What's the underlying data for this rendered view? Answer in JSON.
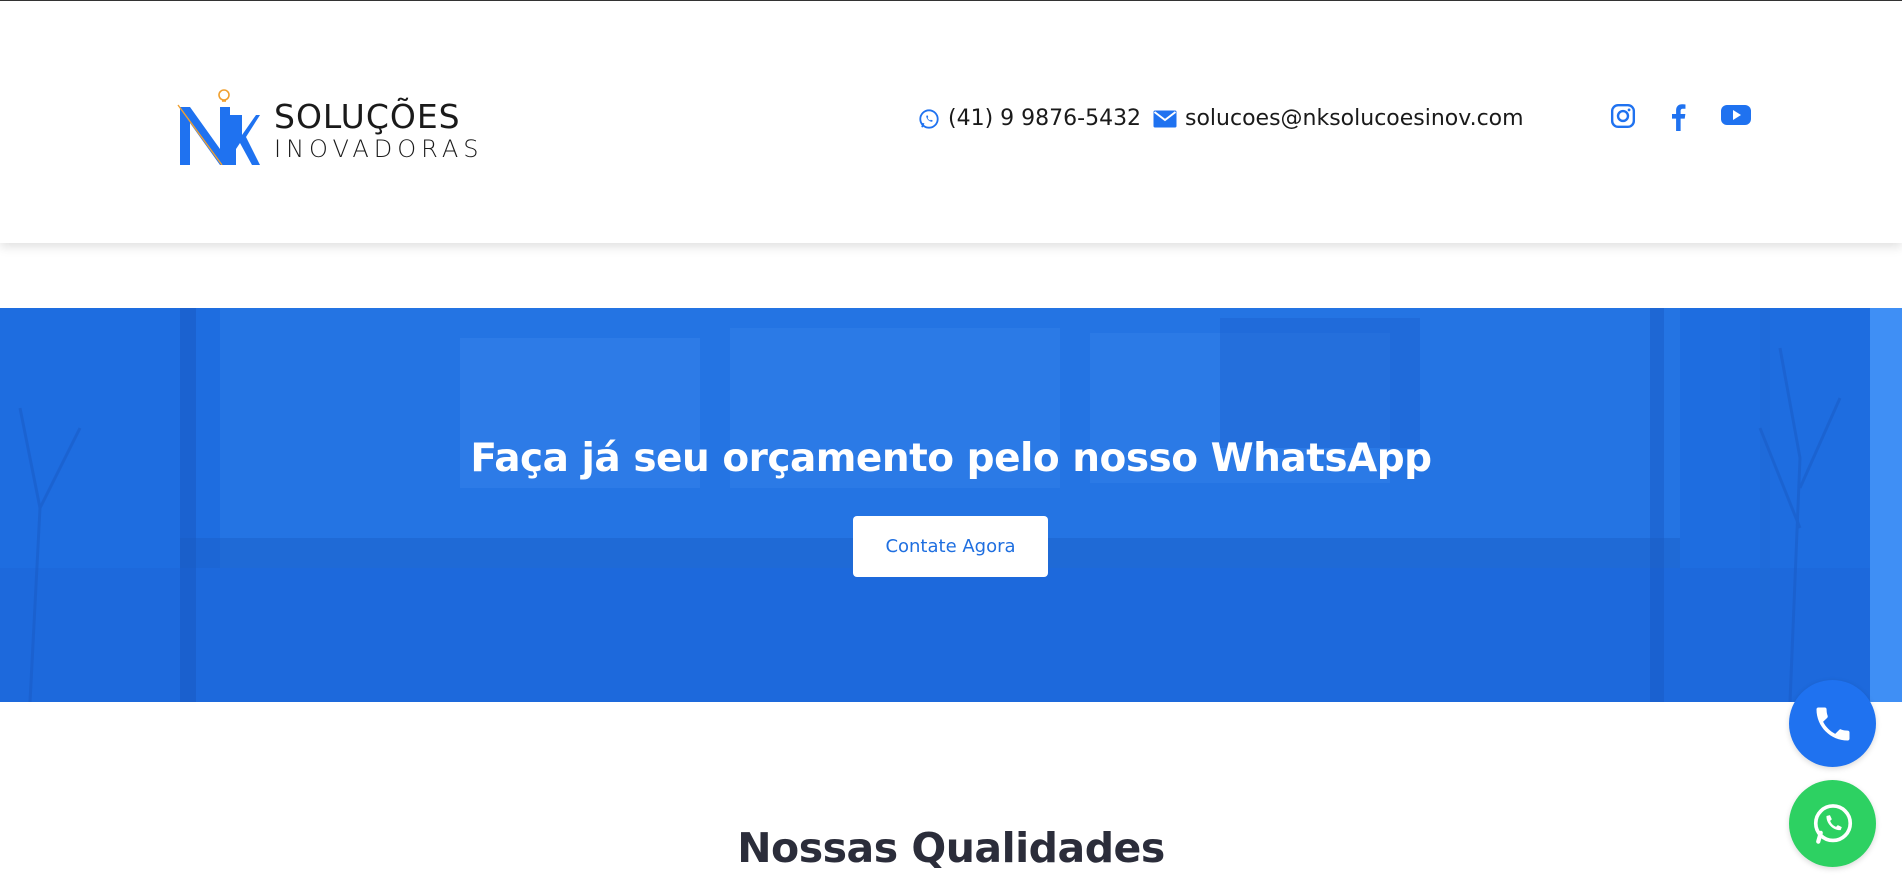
{
  "header": {
    "logo": {
      "line1": "SOLUÇÕES",
      "line2": "INOVADORAS",
      "mark_text": "NK"
    },
    "phone": {
      "icon": "whatsapp-icon",
      "text": "(41) 9 9876-5432"
    },
    "email": {
      "icon": "envelope-icon",
      "text": "solucoes@nksolucoesinov.com"
    },
    "social": [
      {
        "name": "instagram-icon"
      },
      {
        "name": "facebook-icon"
      },
      {
        "name": "youtube-icon"
      }
    ]
  },
  "banner": {
    "title": "Faça já seu orçamento pelo nosso WhatsApp",
    "button_label": "Contate Agora"
  },
  "section": {
    "title": "Nossas Qualidades"
  },
  "floating": {
    "call_icon": "phone-icon",
    "whatsapp_icon": "whatsapp-icon"
  },
  "colors": {
    "accent": "#1f72f0",
    "banner": "#1d6fe0",
    "whatsapp": "#2dd162",
    "heading": "#2b2d3a"
  }
}
